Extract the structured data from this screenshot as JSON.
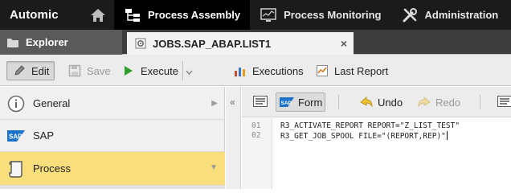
{
  "topbar": {
    "logo": "Automic",
    "tabs": [
      {
        "label": "Process Assembly",
        "icon": "process-assembly-icon"
      },
      {
        "label": "Process Monitoring",
        "icon": "monitor-icon"
      },
      {
        "label": "Administration",
        "icon": "tools-icon"
      }
    ]
  },
  "tabs": {
    "explorer": "Explorer",
    "job": "JOBS.SAP_ABAP.LIST1",
    "close": "×"
  },
  "toolbar": {
    "edit": "Edit",
    "save": "Save",
    "execute": "Execute",
    "executions": "Executions",
    "last_report": "Last Report"
  },
  "sidebar": {
    "items": [
      {
        "label": "General",
        "icon": "info-icon"
      },
      {
        "label": "SAP",
        "icon": "sap-logo-icon"
      },
      {
        "label": "Process",
        "icon": "scroll-icon",
        "selected": true
      }
    ]
  },
  "editor": {
    "collapse": "«",
    "form": "Form",
    "undo": "Undo",
    "redo": "Redo",
    "lines": [
      {
        "num": "01",
        "text": "R3_ACTIVATE_REPORT REPORT=\"Z_LIST_TEST\""
      },
      {
        "num": "02",
        "text": "R3_GET_JOB_SPOOL FILE=\"(REPORT,REP)\""
      }
    ]
  },
  "colors": {
    "topbar": "#1b1b1b",
    "selected_item": "#f8df7c",
    "execute_green": "#2e9e2e"
  }
}
